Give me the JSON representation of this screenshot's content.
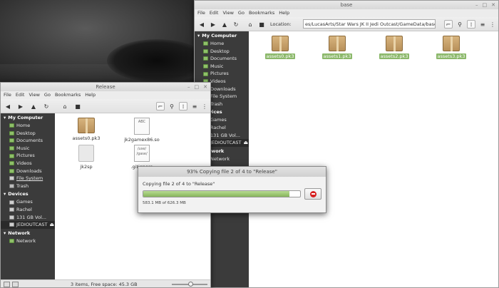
{
  "base_window": {
    "title": "base",
    "menu": [
      "File",
      "Edit",
      "View",
      "Go",
      "Bookmarks",
      "Help"
    ],
    "location_label": "Location:",
    "location_value": "es/LucasArts/Star Wars JK II Jedi Outcast/GameData/base",
    "sidebar": {
      "my_computer": "My Computer",
      "items": [
        "Home",
        "Desktop",
        "Documents",
        "Music",
        "Pictures",
        "Videos",
        "Downloads",
        "File System",
        "Trash"
      ],
      "devices": "Devices",
      "device_items": [
        "Games",
        "Rachel",
        "131 GB Vol...",
        "JEDIOUTCAST"
      ],
      "network": "Network",
      "network_items": [
        "Network"
      ]
    },
    "files": [
      "assets0.pk3",
      "assets1.pk3",
      "assets2.pk3",
      "assets3.pk3"
    ]
  },
  "release_window": {
    "title": "Release",
    "menu": [
      "File",
      "Edit",
      "View",
      "Go",
      "Bookmarks",
      "Help"
    ],
    "sidebar": {
      "my_computer": "My Computer",
      "items": [
        "Home",
        "Desktop",
        "Documents",
        "Music",
        "Pictures",
        "Videos",
        "Downloads",
        "File System",
        "Trash"
      ],
      "devices": "Devices",
      "device_items": [
        "Games",
        "Rachel",
        "131 GB Vol...",
        "JEDIOUTCAST"
      ],
      "network": "Network",
      "network_items": [
        "Network"
      ]
    },
    "files": [
      {
        "name": "assets0.pk3",
        "icon": "package"
      },
      {
        "name": "jk2gamex86.so",
        "icon": "text",
        "preview": "ABC"
      },
      {
        "name": "jk2sp",
        "icon": "blank"
      },
      {
        "name": ".gitignore",
        "icon": "text",
        "preview": "/use/ /gase/"
      }
    ],
    "status": "3 items, Free space: 45.3 GB"
  },
  "dialog": {
    "title": "93% Copying file 2 of 4 to \"Release\"",
    "message": "Copying file 2 of 4 to \"Release\"",
    "progress": 0.93,
    "details": "583.1 MB of 626.3 MB"
  }
}
